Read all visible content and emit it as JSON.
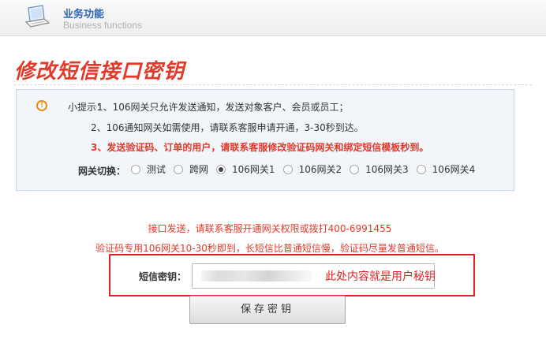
{
  "header": {
    "title": "业务功能",
    "subtitle": "Business functions",
    "icon": "laptop-icon"
  },
  "page_title": "修改短信接口密钥",
  "tips": {
    "label": "小提示：",
    "line1": "1、106网关只允许发送通知，发送对象客户、会员或员工；",
    "line2": "2、106通知网关如需使用，请联系客服申请开通，3-30秒到达。",
    "line3": "3、发送验证码、订单的用户，请联系客服修改验证码网关和绑定短信模板秒到。"
  },
  "gateway": {
    "label": "网关切换：",
    "options": [
      {
        "label": "测试",
        "checked": false
      },
      {
        "label": "跨网",
        "checked": false
      },
      {
        "label": "106网关1",
        "checked": true
      },
      {
        "label": "106网关2",
        "checked": false
      },
      {
        "label": "106网关3",
        "checked": false
      },
      {
        "label": "106网关4",
        "checked": false
      }
    ]
  },
  "notices": {
    "line1": "接口发送，请联系客服开通网关权限或拨打400-6991455",
    "line2": "验证码专用106网关10-30秒即到，长短信比普通短信慢，验证码尽量发普通短信。"
  },
  "key_field": {
    "label": "短信密钥：",
    "annotation": "此处内容就是用户秘钥"
  },
  "save_button": "保存密钥",
  "colors": {
    "accent_red": "#e03a2a",
    "header_blue": "#2d66b3",
    "tip_bg": "#f2f6fb",
    "highlight_border": "#e02222"
  }
}
